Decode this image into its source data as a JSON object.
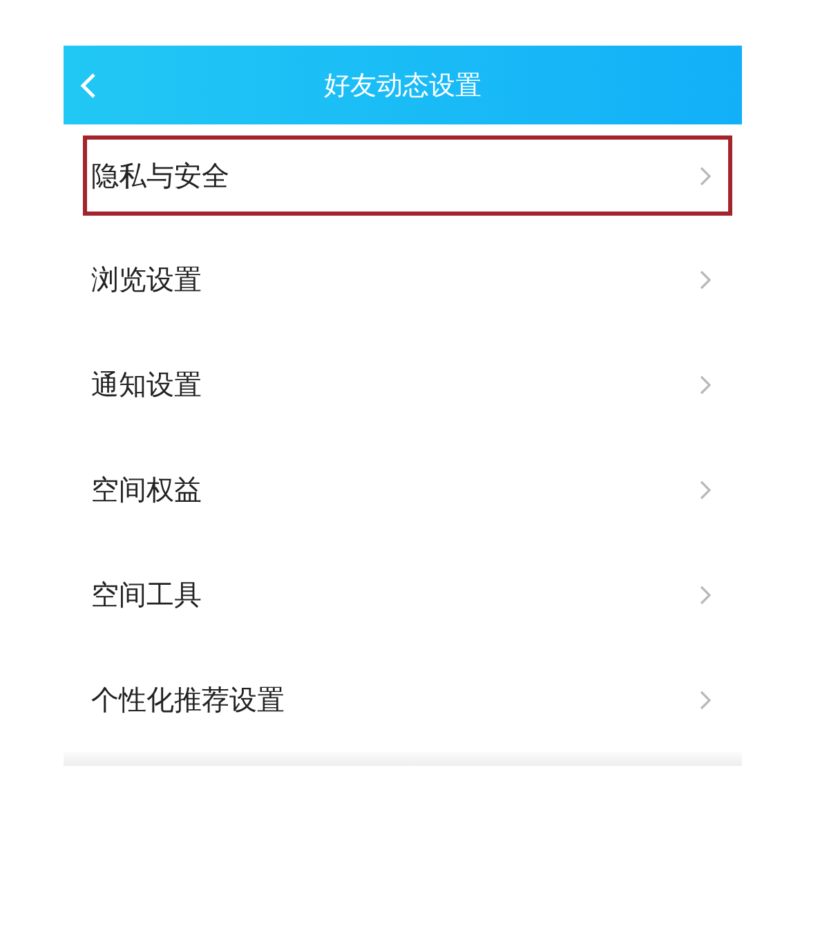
{
  "header": {
    "title": "好友动态设置"
  },
  "items": [
    {
      "label": "隐私与安全",
      "highlighted": true
    },
    {
      "label": "浏览设置",
      "highlighted": false
    },
    {
      "label": "通知设置",
      "highlighted": false
    },
    {
      "label": "空间权益",
      "highlighted": false
    },
    {
      "label": "空间工具",
      "highlighted": false
    },
    {
      "label": "个性化推荐设置",
      "highlighted": false
    }
  ]
}
